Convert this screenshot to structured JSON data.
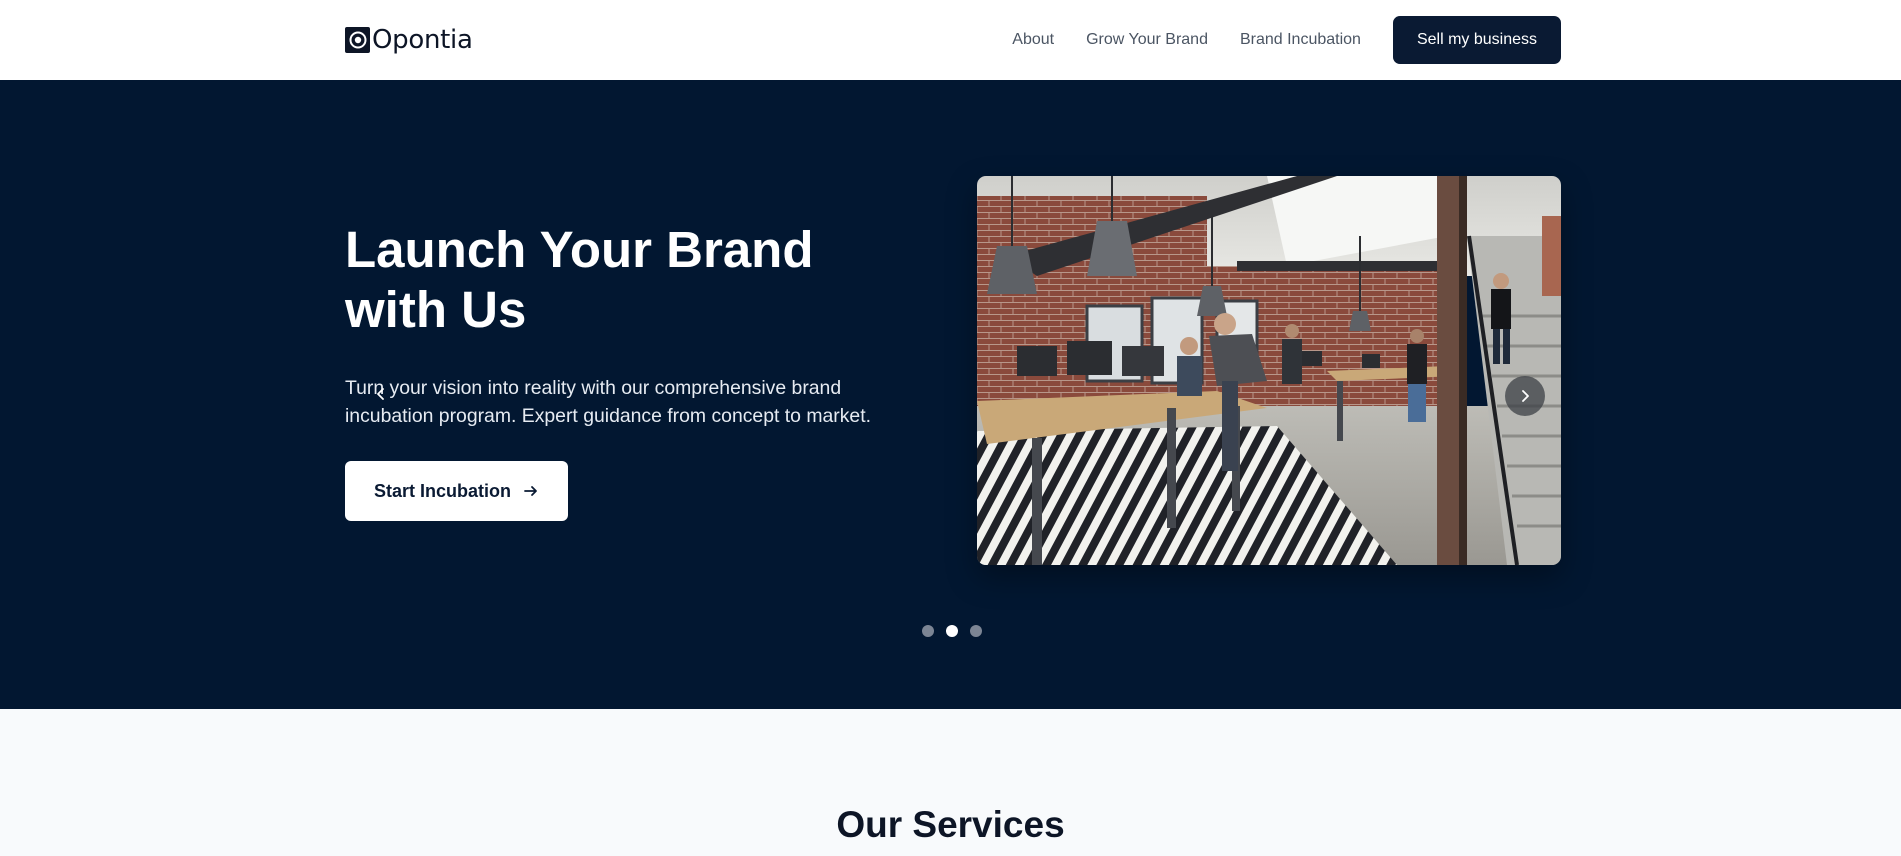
{
  "header": {
    "brand_name": "Opontia",
    "nav": [
      "About",
      "Grow Your Brand",
      "Brand Incubation"
    ],
    "cta_label": "Sell my business"
  },
  "hero": {
    "title": "Launch Your Brand with Us",
    "description": "Turn your vision into reality with our comprehensive brand incubation program. Expert guidance from concept to market.",
    "button_label": "Start Incubation",
    "slide_count": 3,
    "active_slide": 2
  },
  "services": {
    "title": "Our Services"
  },
  "colors": {
    "hero_background": "#021731",
    "primary": "#0a1a33",
    "services_background": "#f8fafc"
  },
  "icons": {
    "logo": "target-logo-icon",
    "button_arrow": "arrow-right-icon",
    "prev": "chevron-left-icon",
    "next": "chevron-right-icon"
  }
}
